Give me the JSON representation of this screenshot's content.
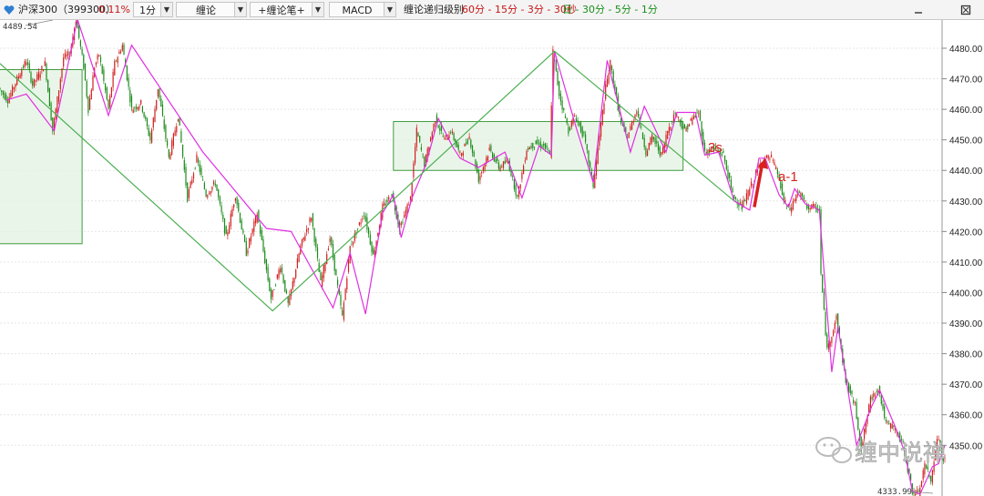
{
  "toolbar": {
    "heart_icon": "heart-icon",
    "symbol": "沪深300（399300）",
    "change": "0.11%",
    "period": "1分",
    "indicator1": "缠论",
    "indicator2": "+缠论笔+",
    "indicator3": "MACD",
    "recursion_label": "缠论递归级别",
    "levels_red": "60分 - 15分 - 3分 - 30秒",
    "levels_green": "日 - 30分 - 5分 - 1分",
    "dropdown_icon": "dropdown-arrow-icon",
    "minimize_icon": "minimize-icon",
    "maximize_icon": "maximize-icon"
  },
  "annotations": {
    "three_s": "3s",
    "a_minus_1": "a-1"
  },
  "high_label": "4489.54",
  "low_label": "4333.99",
  "watermark": "缠中说禅",
  "colors": {
    "candle_up": "#d11f1f",
    "candle_down": "#1a8a1a",
    "stroke": "#e030e0",
    "segment": "#4caf50",
    "zone_fill": "#e3f2e3",
    "zone_border": "#3f9c3f",
    "annotation": "#d82020"
  },
  "chart_data": {
    "type": "candlestick",
    "ylim": [
      4330,
      4493
    ],
    "yticks": [
      "4480.00",
      "4470.00",
      "4460.00",
      "4450.00",
      "4440.00",
      "4430.00",
      "4420.00",
      "4410.00",
      "4400.00",
      "4390.00",
      "4380.00",
      "4370.00",
      "4360.00",
      "4350.00"
    ],
    "bars": 300,
    "stroke_pivots": [
      [
        0,
        4467
      ],
      [
        6,
        4463
      ],
      [
        13,
        4471
      ],
      [
        18,
        4476
      ],
      [
        22,
        4468
      ],
      [
        30,
        4475
      ],
      [
        35,
        4453
      ],
      [
        42,
        4477
      ],
      [
        46,
        4478
      ],
      [
        50,
        4489.54
      ],
      [
        55,
        4474
      ],
      [
        58,
        4460
      ],
      [
        62,
        4474
      ],
      [
        65,
        4478
      ],
      [
        71,
        4460
      ],
      [
        75,
        4475
      ],
      [
        80,
        4481
      ],
      [
        86,
        4460
      ],
      [
        92,
        4462
      ],
      [
        98,
        4450
      ],
      [
        103,
        4467
      ],
      [
        110,
        4444
      ],
      [
        116,
        4458
      ],
      [
        122,
        4431
      ],
      [
        128,
        4444
      ],
      [
        134,
        4432
      ],
      [
        140,
        4436
      ],
      [
        147,
        4418
      ],
      [
        153,
        4432
      ],
      [
        160,
        4413
      ],
      [
        167,
        4426
      ],
      [
        176,
        4398
      ],
      [
        182,
        4409
      ],
      [
        187,
        4396
      ],
      [
        195,
        4415
      ],
      [
        202,
        4425
      ],
      [
        208,
        4403
      ],
      [
        214,
        4418
      ],
      [
        222,
        4392
      ],
      [
        227,
        4415
      ],
      [
        236,
        4426
      ],
      [
        242,
        4412
      ],
      [
        248,
        4428
      ],
      [
        254,
        4432
      ],
      [
        259,
        4421
      ],
      [
        266,
        4431
      ],
      [
        270,
        4453
      ],
      [
        275,
        4442
      ],
      [
        282,
        4457
      ],
      [
        288,
        4450
      ],
      [
        292,
        4453
      ],
      [
        298,
        4445
      ],
      [
        304,
        4451
      ],
      [
        310,
        4437
      ],
      [
        317,
        4447
      ],
      [
        323,
        4441
      ],
      [
        329,
        4443
      ],
      [
        335,
        4431
      ],
      [
        341,
        4447
      ],
      [
        347,
        4449
      ],
      [
        352,
        4448
      ],
      [
        356,
        4445
      ],
      [
        358,
        4479
      ],
      [
        362,
        4465
      ],
      [
        368,
        4453
      ],
      [
        372,
        4458
      ],
      [
        378,
        4451
      ],
      [
        384,
        4435
      ],
      [
        392,
        4467
      ],
      [
        395,
        4475
      ],
      [
        402,
        4455
      ],
      [
        406,
        4451
      ],
      [
        412,
        4460
      ],
      [
        418,
        4446
      ],
      [
        422,
        4451
      ],
      [
        428,
        4445
      ],
      [
        432,
        4453
      ],
      [
        437,
        4459
      ],
      [
        443,
        4453
      ],
      [
        448,
        4457
      ],
      [
        452,
        4459
      ],
      [
        456,
        4446
      ],
      [
        462,
        4447
      ],
      [
        468,
        4445
      ],
      [
        474,
        4432
      ],
      [
        480,
        4428
      ],
      [
        485,
        4434
      ],
      [
        490,
        4440
      ],
      [
        494,
        4444
      ],
      [
        499,
        4444
      ],
      [
        503,
        4439
      ],
      [
        507,
        4430
      ],
      [
        511,
        4427
      ],
      [
        516,
        4433
      ],
      [
        519,
        4431
      ],
      [
        522,
        4428
      ],
      [
        526,
        4428
      ],
      [
        530,
        4427
      ],
      [
        531,
        4406
      ],
      [
        535,
        4381
      ],
      [
        541,
        4392
      ],
      [
        547,
        4371
      ],
      [
        553,
        4363
      ],
      [
        557,
        4349
      ],
      [
        563,
        4365
      ],
      [
        568,
        4369
      ],
      [
        573,
        4357
      ],
      [
        578,
        4356
      ],
      [
        584,
        4350
      ],
      [
        590,
        4335
      ],
      [
        594,
        4333.99
      ],
      [
        598,
        4344
      ],
      [
        602,
        4338
      ],
      [
        606,
        4353
      ],
      [
        610,
        4345
      ]
    ],
    "strokes": [
      [
        4,
        4463
      ],
      [
        17,
        4465
      ],
      [
        35,
        4453
      ],
      [
        50,
        4489.54
      ],
      [
        70,
        4458
      ],
      [
        85,
        4481
      ],
      [
        131,
        4446
      ],
      [
        172,
        4421
      ],
      [
        188,
        4420
      ],
      [
        215,
        4395
      ],
      [
        226,
        4413
      ],
      [
        236,
        4393
      ],
      [
        247,
        4426
      ],
      [
        254,
        4432
      ],
      [
        259,
        4418
      ],
      [
        266,
        4431
      ],
      [
        275,
        4442
      ],
      [
        283,
        4457
      ],
      [
        292,
        4448
      ],
      [
        297,
        4444
      ],
      [
        309,
        4441
      ],
      [
        326,
        4446
      ],
      [
        337,
        4431
      ],
      [
        348,
        4448
      ],
      [
        356,
        4445
      ],
      [
        358,
        4479
      ],
      [
        372,
        4454
      ],
      [
        383,
        4436
      ],
      [
        392,
        4476
      ],
      [
        407,
        4446
      ],
      [
        416,
        4461
      ],
      [
        430,
        4446
      ],
      [
        437,
        4459
      ],
      [
        449,
        4459
      ],
      [
        455,
        4445
      ],
      [
        464,
        4446
      ],
      [
        474,
        4430
      ],
      [
        484,
        4427
      ],
      [
        490,
        4444
      ],
      [
        494,
        4444
      ],
      [
        503,
        4432
      ],
      [
        509,
        4428
      ],
      [
        513,
        4434
      ],
      [
        520,
        4429
      ],
      [
        525,
        4428
      ],
      [
        529,
        4427
      ],
      [
        537,
        4374
      ],
      [
        541,
        4389
      ],
      [
        553,
        4350
      ],
      [
        563,
        4363
      ],
      [
        568,
        4368
      ],
      [
        578,
        4356
      ],
      [
        584,
        4348
      ],
      [
        589,
        4335
      ],
      [
        594,
        4334
      ],
      [
        602,
        4343
      ],
      [
        606,
        4344
      ],
      [
        610,
        4350
      ]
    ],
    "segments": [
      [
        0,
        4475
      ],
      [
        176,
        4394
      ],
      [
        358,
        4479
      ],
      [
        474,
        4430
      ]
    ],
    "zones": [
      {
        "x1": -5,
        "x2": 53,
        "y_low": 4416,
        "y_high": 4473
      },
      {
        "x1": 254,
        "x2": 441,
        "y_low": 4440,
        "y_high": 4456
      }
    ],
    "arrow": {
      "from": [
        487,
        4428
      ],
      "to": [
        494,
        4444
      ]
    }
  }
}
